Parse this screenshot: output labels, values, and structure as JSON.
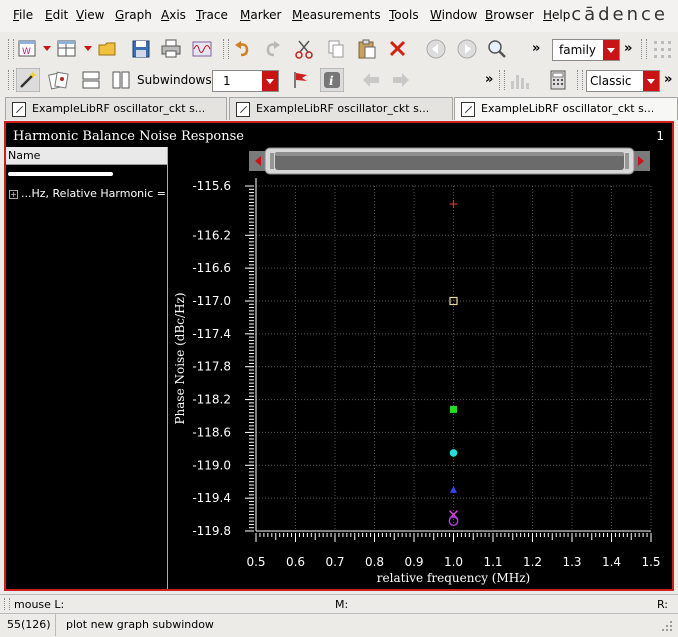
{
  "menu": [
    "File",
    "Edit",
    "View",
    "Graph",
    "Axis",
    "Trace",
    "Marker",
    "Measurements",
    "Tools",
    "Window",
    "Browser",
    "Help"
  ],
  "logo": "cādence",
  "toolbar1": {
    "family_value": "family"
  },
  "toolbar2": {
    "subwindows_label": "Subwindows:",
    "subwindows_value": "1",
    "style_value": "Classic"
  },
  "tabs": [
    {
      "label": "ExampleLibRF oscillator_ckt s...",
      "active": false
    },
    {
      "label": "ExampleLibRF oscillator_ckt s...",
      "active": false
    },
    {
      "label": "ExampleLibRF oscillator_ckt s...",
      "active": true
    }
  ],
  "graph": {
    "title": "Harmonic Balance Noise Response",
    "index": "1",
    "legend_header": "Name",
    "legend_row": "...Hz, Relative Harmonic ="
  },
  "chart_data": {
    "type": "scatter",
    "xlabel": "relative frequency (MHz)",
    "ylabel": "Phase Noise (dBc/Hz)",
    "xlim": [
      0.5,
      1.5
    ],
    "ylim": [
      -119.8,
      -115.6
    ],
    "xticks": [
      "0.5",
      "0.6",
      "0.7",
      "0.8",
      "0.9",
      "1.0",
      "1.1",
      "1.2",
      "1.3",
      "1.4",
      "1.5"
    ],
    "yticks": [
      "-115.6",
      "-116.2",
      "-116.6",
      "-117.0",
      "-117.4",
      "-117.8",
      "-118.2",
      "-118.6",
      "-119.0",
      "-119.4",
      "-119.8"
    ],
    "ytick_values": [
      -115.6,
      -116.2,
      -116.6,
      -117.0,
      -117.4,
      -117.8,
      -118.2,
      -118.6,
      -119.0,
      -119.4,
      -119.8
    ],
    "grid": true,
    "series": [
      {
        "x": 1.0,
        "y": -115.82,
        "marker": "plus",
        "color": "#e03030"
      },
      {
        "x": 1.0,
        "y": -117.0,
        "marker": "square-open",
        "color": "#e8d89a"
      },
      {
        "x": 1.0,
        "y": -118.32,
        "marker": "square",
        "color": "#22dd22"
      },
      {
        "x": 1.0,
        "y": -118.85,
        "marker": "circle",
        "color": "#22dddd"
      },
      {
        "x": 1.0,
        "y": -119.3,
        "marker": "triangle",
        "color": "#3344ff"
      },
      {
        "x": 1.0,
        "y": -119.6,
        "marker": "x",
        "color": "#e040e0"
      },
      {
        "x": 1.0,
        "y": -119.68,
        "marker": "circle-open",
        "color": "#b040e0"
      }
    ]
  },
  "status1": {
    "left": "mouse L:",
    "middle": "M:",
    "right": "R:"
  },
  "status2": {
    "left": "55(126)",
    "message": "plot new graph subwindow"
  },
  "colors": {
    "frame_border": "#cc2020",
    "accent_red": "#c81414",
    "plot_bg": "#000000"
  }
}
